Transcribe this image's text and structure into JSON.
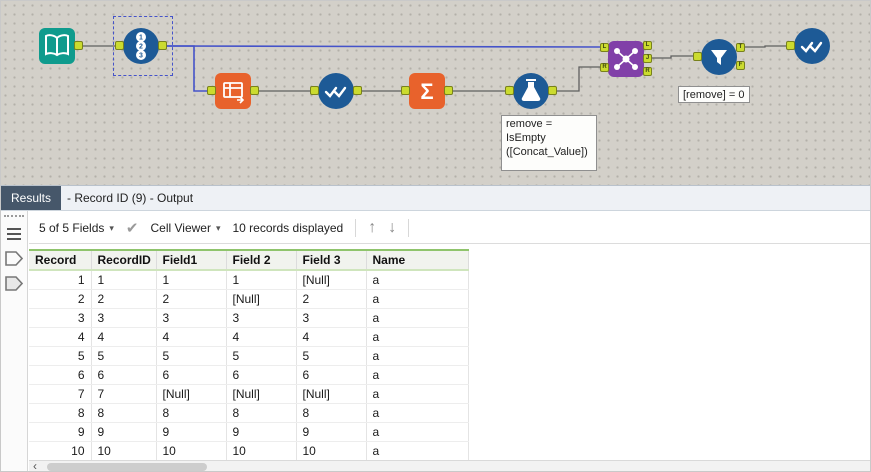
{
  "colors": {
    "selection_blue": "#4553c9",
    "anchor_green": "#cbdb2f",
    "accent_green": "#8fc46c",
    "tool_blue": "#1d5a96",
    "tool_orange": "#e8622c",
    "tool_purple": "#8140a8",
    "tool_teal": "#0f9b8d"
  },
  "canvas": {
    "record_id_digits": [
      "1",
      "2",
      "3"
    ],
    "summarize_sigma": "Σ",
    "anchors": {
      "join_left": [
        "L",
        "R"
      ],
      "join_right": [
        "L",
        "J",
        "R"
      ],
      "filter_right": [
        "T",
        "F"
      ]
    },
    "annotations": {
      "formula_note": "remove =\nIsEmpty\n([Concat_Value])",
      "filter_note": "[remove] = 0"
    }
  },
  "results": {
    "tab": "Results",
    "title": "- Record ID (9) - Output",
    "toolbar": {
      "fields": "5 of 5 Fields",
      "cell_viewer": "Cell Viewer",
      "records": "10 records displayed"
    },
    "table": {
      "null_marker": "[Null]",
      "columns": [
        "Record",
        "RecordID",
        "Field1",
        "Field 2",
        "Field 3",
        "Name"
      ],
      "rows": [
        [
          "1",
          "1",
          "1",
          "1",
          "[Null]",
          "a"
        ],
        [
          "2",
          "2",
          "2",
          "[Null]",
          "2",
          "a"
        ],
        [
          "3",
          "3",
          "3",
          "3",
          "3",
          "a"
        ],
        [
          "4",
          "4",
          "4",
          "4",
          "4",
          "a"
        ],
        [
          "5",
          "5",
          "5",
          "5",
          "5",
          "a"
        ],
        [
          "6",
          "6",
          "6",
          "6",
          "6",
          "a"
        ],
        [
          "7",
          "7",
          "[Null]",
          "[Null]",
          "[Null]",
          "a"
        ],
        [
          "8",
          "8",
          "8",
          "8",
          "8",
          "a"
        ],
        [
          "9",
          "9",
          "9",
          "9",
          "9",
          "a"
        ],
        [
          "10",
          "10",
          "10",
          "10",
          "10",
          "a"
        ]
      ]
    }
  }
}
